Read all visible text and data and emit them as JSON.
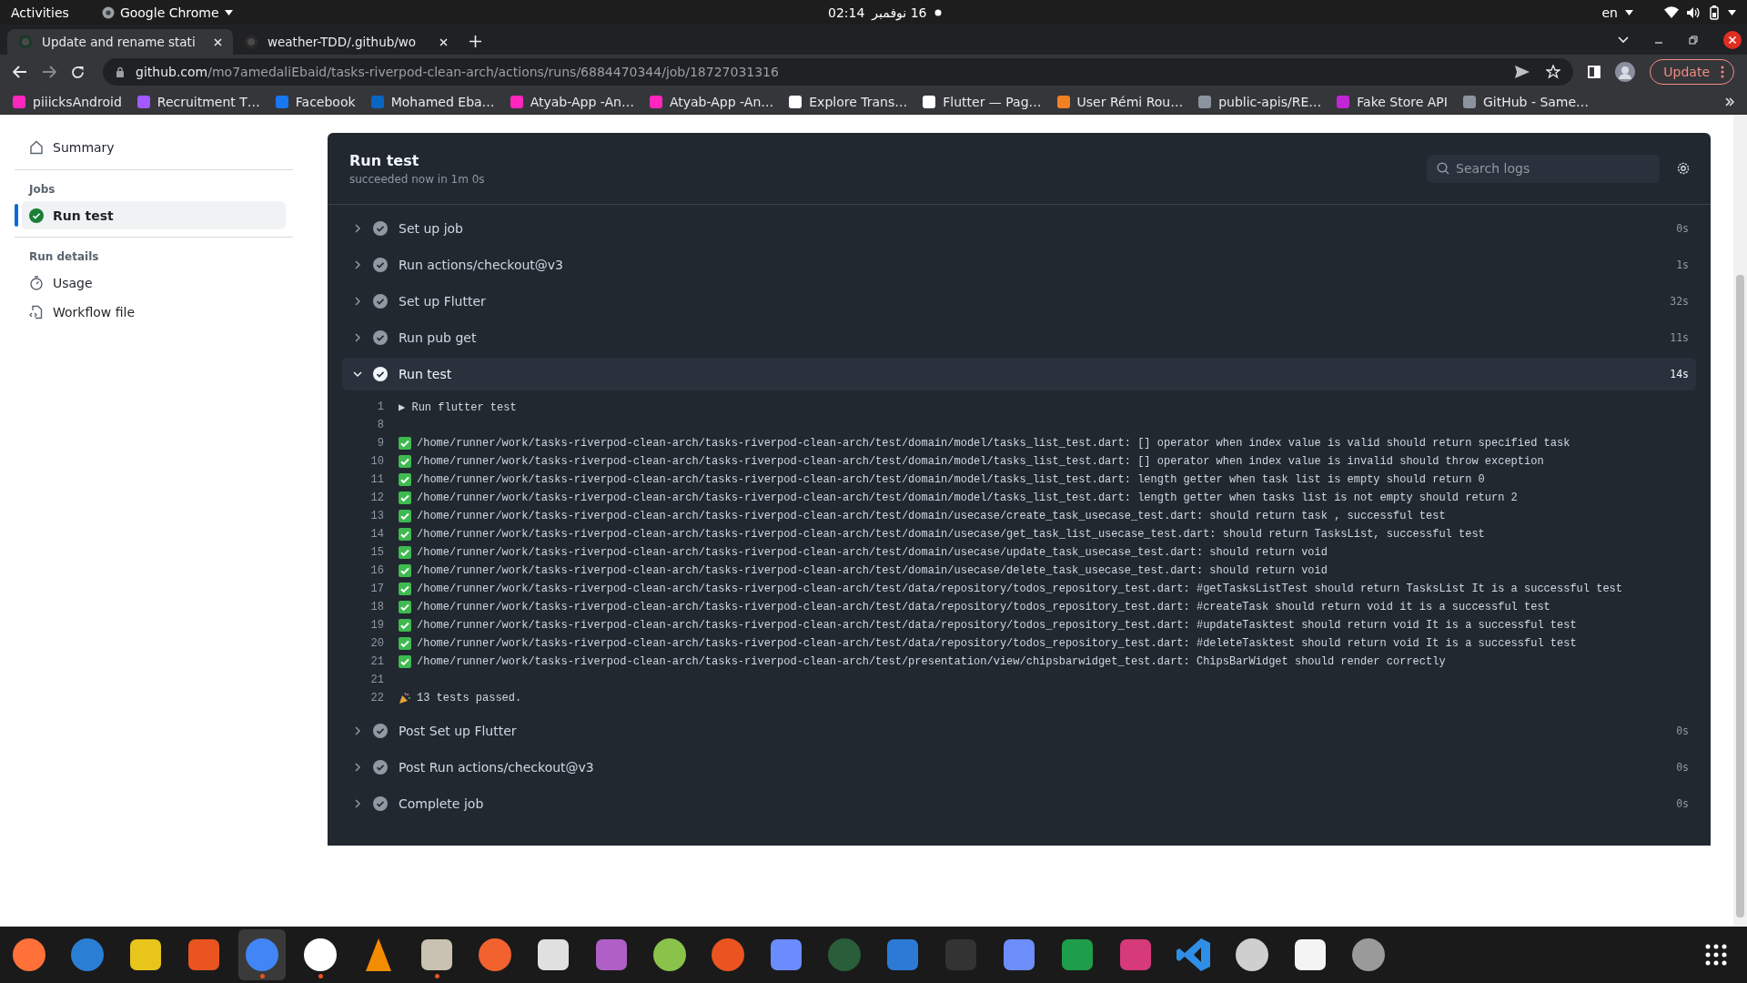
{
  "system_bar": {
    "activities": "Activities",
    "app": "Google Chrome",
    "clock": "02:14",
    "date": "16 نوفمبر",
    "language": "en"
  },
  "browser": {
    "tabs": [
      {
        "title": "Update and rename stati",
        "selected": true
      },
      {
        "title": "weather-TDD/.github/wo",
        "selected": false
      }
    ],
    "url_host": "github.com",
    "url_path": "/mo7amedaliEbaid/tasks-riverpod-clean-arch/actions/runs/6884470344/job/18727031316",
    "update_button": "Update",
    "bookmarks": [
      {
        "title": "piiicksAndroid",
        "color": "#ff26be"
      },
      {
        "title": "Recruitment T…",
        "color": "#a259ff"
      },
      {
        "title": "Facebook",
        "color": "#1877f2"
      },
      {
        "title": "Mohamed Eba…",
        "color": "#0a66c2"
      },
      {
        "title": "Atyab-App -An…",
        "color": "#ff26be"
      },
      {
        "title": "Atyab-App -An…",
        "color": "#ff26be"
      },
      {
        "title": "Explore Trans…",
        "color": "#ffffff"
      },
      {
        "title": "Flutter — Pag…",
        "color": "#ffffff"
      },
      {
        "title": "User Rémi Rou…",
        "color": "#f48024"
      },
      {
        "title": "public-apis/RE…",
        "color": "#8b949e"
      },
      {
        "title": "Fake Store API",
        "color": "#c026d3"
      },
      {
        "title": "GitHub - Same…",
        "color": "#8b949e"
      }
    ]
  },
  "sidebar": {
    "summary": "Summary",
    "jobs_heading": "Jobs",
    "jobs": [
      {
        "name": "Run test",
        "selected": true
      }
    ],
    "details_heading": "Run details",
    "details": [
      {
        "kind": "usage",
        "label": "Usage"
      },
      {
        "kind": "workflow",
        "label": "Workflow file"
      }
    ]
  },
  "job": {
    "title": "Run test",
    "subtitle": "succeeded now in 1m 0s",
    "search": {
      "placeholder": "Search logs"
    },
    "steps": [
      {
        "name": "Set up job",
        "duration": "0s",
        "expanded": false
      },
      {
        "name": "Run actions/checkout@v3",
        "duration": "1s",
        "expanded": false
      },
      {
        "name": "Set up Flutter",
        "duration": "32s",
        "expanded": false
      },
      {
        "name": "Run pub get",
        "duration": "11s",
        "expanded": false
      },
      {
        "name": "Run test",
        "duration": "14s",
        "expanded": true,
        "log": [
          {
            "number": "1",
            "kind": "group",
            "marker": "▶",
            "text": "Run flutter test"
          },
          {
            "number": "8",
            "kind": "blank"
          },
          {
            "number": "9",
            "kind": "pass",
            "text": "/home/runner/work/tasks-riverpod-clean-arch/tasks-riverpod-clean-arch/test/domain/model/tasks_list_test.dart: [] operator when index value is valid should return specified task"
          },
          {
            "number": "10",
            "kind": "pass",
            "text": "/home/runner/work/tasks-riverpod-clean-arch/tasks-riverpod-clean-arch/test/domain/model/tasks_list_test.dart: [] operator when index value is invalid should throw exception"
          },
          {
            "number": "11",
            "kind": "pass",
            "text": "/home/runner/work/tasks-riverpod-clean-arch/tasks-riverpod-clean-arch/test/domain/model/tasks_list_test.dart: length getter when task list is empty should return 0"
          },
          {
            "number": "12",
            "kind": "pass",
            "text": "/home/runner/work/tasks-riverpod-clean-arch/tasks-riverpod-clean-arch/test/domain/model/tasks_list_test.dart: length getter when tasks list is not empty should return 2"
          },
          {
            "number": "13",
            "kind": "pass",
            "text": "/home/runner/work/tasks-riverpod-clean-arch/tasks-riverpod-clean-arch/test/domain/usecase/create_task_usecase_test.dart: should return task , successful test"
          },
          {
            "number": "14",
            "kind": "pass",
            "text": "/home/runner/work/tasks-riverpod-clean-arch/tasks-riverpod-clean-arch/test/domain/usecase/get_task_list_usecase_test.dart: should return TasksList, successful test"
          },
          {
            "number": "15",
            "kind": "pass",
            "text": "/home/runner/work/tasks-riverpod-clean-arch/tasks-riverpod-clean-arch/test/domain/usecase/update_task_usecase_test.dart: should return void"
          },
          {
            "number": "16",
            "kind": "pass",
            "text": "/home/runner/work/tasks-riverpod-clean-arch/tasks-riverpod-clean-arch/test/domain/usecase/delete_task_usecase_test.dart: should return void"
          },
          {
            "number": "17",
            "kind": "pass",
            "text": "/home/runner/work/tasks-riverpod-clean-arch/tasks-riverpod-clean-arch/test/data/repository/todos_repository_test.dart: #getTasksListTest should return TasksList It is a successful test"
          },
          {
            "number": "18",
            "kind": "pass",
            "text": "/home/runner/work/tasks-riverpod-clean-arch/tasks-riverpod-clean-arch/test/data/repository/todos_repository_test.dart: #createTask should return void it is a successful test"
          },
          {
            "number": "19",
            "kind": "pass",
            "text": "/home/runner/work/tasks-riverpod-clean-arch/tasks-riverpod-clean-arch/test/data/repository/todos_repository_test.dart: #updateTasktest should return void It is a successful test"
          },
          {
            "number": "20",
            "kind": "pass",
            "text": "/home/runner/work/tasks-riverpod-clean-arch/tasks-riverpod-clean-arch/test/data/repository/todos_repository_test.dart: #deleteTasktest should return void It is a successful test"
          },
          {
            "number": "21",
            "kind": "pass",
            "text": "/home/runner/work/tasks-riverpod-clean-arch/tasks-riverpod-clean-arch/test/presentation/view/chipsbarwidget_test.dart: ChipsBarWidget should render correctly"
          },
          {
            "number": "21",
            "kind": "blank"
          },
          {
            "number": "22",
            "kind": "summary",
            "text": "13 tests passed."
          }
        ]
      },
      {
        "name": "Post Set up Flutter",
        "duration": "0s",
        "expanded": false
      },
      {
        "name": "Post Run actions/checkout@v3",
        "duration": "0s",
        "expanded": false
      },
      {
        "name": "Complete job",
        "duration": "0s",
        "expanded": false
      }
    ]
  },
  "dock": [
    {
      "running": false
    },
    {
      "running": false
    },
    {
      "running": false
    },
    {
      "running": false
    },
    {
      "running": true,
      "selected": true
    },
    {
      "running": true
    },
    {
      "running": false
    },
    {
      "running": true
    },
    {
      "running": false
    },
    {
      "running": false
    },
    {
      "running": false
    },
    {
      "running": false
    },
    {
      "running": false
    },
    {
      "running": false
    },
    {
      "running": false
    },
    {
      "running": false
    },
    {
      "running": false
    },
    {
      "running": false
    },
    {
      "running": false
    },
    {
      "running": false
    },
    {
      "running": false
    },
    {
      "running": false
    },
    {
      "running": false
    },
    {
      "running": false
    }
  ]
}
